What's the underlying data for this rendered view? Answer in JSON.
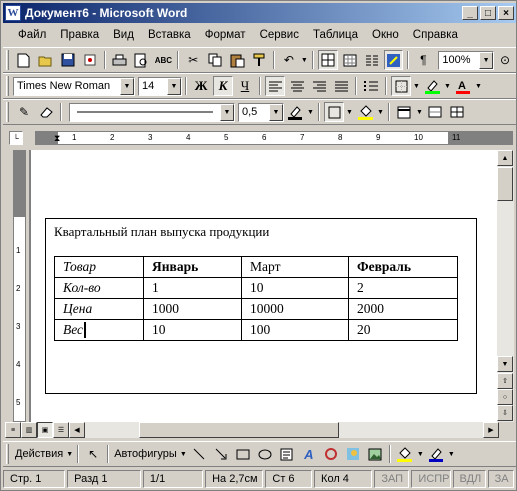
{
  "window": {
    "title": "Документ6 - Microsoft Word",
    "app_icon": "W"
  },
  "menu": [
    "Файл",
    "Правка",
    "Вид",
    "Вставка",
    "Формат",
    "Сервис",
    "Таблица",
    "Окно",
    "Справка"
  ],
  "standard_toolbar": {
    "zoom": "100%"
  },
  "format_toolbar": {
    "font": "Times New Roman",
    "size": "14",
    "bold": "Ж",
    "italic": "К",
    "underline": "Ч"
  },
  "borders_toolbar": {
    "line_weight": "0,5"
  },
  "ruler": {
    "h_ticks": [
      "1",
      "2",
      "3",
      "4",
      "5",
      "6",
      "7",
      "8",
      "9",
      "10",
      "11"
    ],
    "v_ticks": [
      "1",
      "2",
      "3",
      "4",
      "5"
    ]
  },
  "document": {
    "heading": "Квартальный план выпуска продукции",
    "table": {
      "header": [
        "Товар",
        "Январь",
        "Март",
        "Февраль"
      ],
      "rows": [
        [
          "Кол-во",
          "1",
          "10",
          "2"
        ],
        [
          "Цена",
          "1000",
          "10000",
          "2000"
        ],
        [
          "Вес",
          "10",
          "100",
          "20"
        ]
      ]
    }
  },
  "drawing_toolbar": {
    "actions": "Действия",
    "autoshapes": "Автофигуры"
  },
  "status": {
    "page": "Стр. 1",
    "section": "Разд 1",
    "pages": "1/1",
    "at": "На 2,7см",
    "line": "Ст 6",
    "col": "Кол 4",
    "rec": "ЗАП",
    "trk": "ИСПР",
    "ext": "ВДЛ",
    "ovr": "ЗА"
  },
  "colors": {
    "title_start": "#0a246a",
    "title_end": "#a6caf0",
    "highlight": "#ffff00",
    "fontcolor": "#ff0000",
    "fill": "#ffff00"
  }
}
